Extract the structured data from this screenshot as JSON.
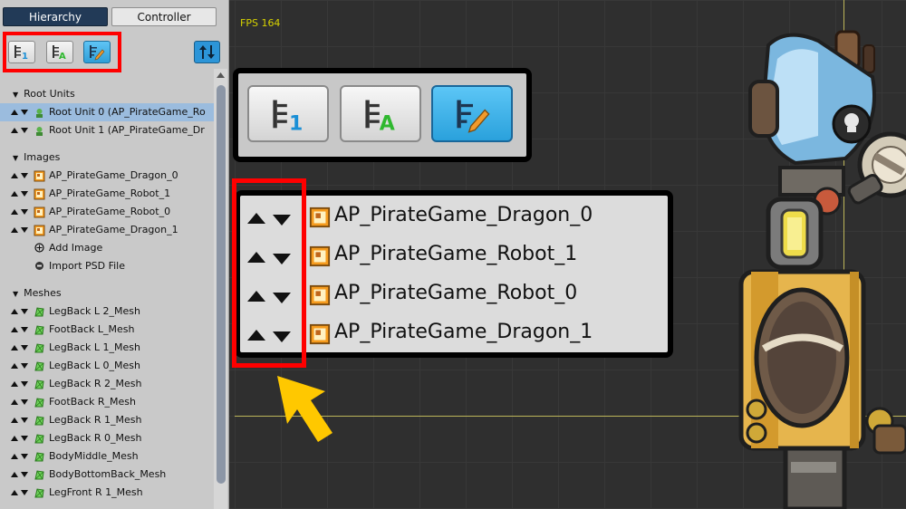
{
  "tabs": {
    "hierarchy": "Hierarchy",
    "controller": "Controller"
  },
  "viewport": {
    "fps": "FPS 164"
  },
  "sections": {
    "root_units": "Root Units",
    "images": "Images",
    "meshes": "Meshes"
  },
  "root_units": [
    {
      "label": "Root Unit 0 (AP_PirateGame_Ro",
      "selected": true
    },
    {
      "label": "Root Unit 1 (AP_PirateGame_Dr",
      "selected": false
    }
  ],
  "images": [
    {
      "label": "AP_PirateGame_Dragon_0"
    },
    {
      "label": "AP_PirateGame_Robot_1"
    },
    {
      "label": "AP_PirateGame_Robot_0"
    },
    {
      "label": "AP_PirateGame_Dragon_1"
    }
  ],
  "image_actions": {
    "add_image": "Add Image",
    "import_psd": "Import PSD File"
  },
  "meshes": [
    {
      "label": "LegBack L 2_Mesh"
    },
    {
      "label": "FootBack L_Mesh"
    },
    {
      "label": "LegBack L 1_Mesh"
    },
    {
      "label": "LegBack L 0_Mesh"
    },
    {
      "label": "LegBack R 2_Mesh"
    },
    {
      "label": "FootBack R_Mesh"
    },
    {
      "label": "LegBack R 1_Mesh"
    },
    {
      "label": "LegBack R 0_Mesh"
    },
    {
      "label": "BodyMiddle_Mesh"
    },
    {
      "label": "BodyBottomBack_Mesh"
    },
    {
      "label": "LegFront R 1_Mesh"
    }
  ],
  "zoom_list": [
    {
      "label": "AP_PirateGame_Dragon_0"
    },
    {
      "label": "AP_PirateGame_Robot_1"
    },
    {
      "label": "AP_PirateGame_Robot_0"
    },
    {
      "label": "AP_PirateGame_Dragon_1"
    }
  ],
  "icons": {
    "sort_by_number": "sort-number-icon",
    "sort_alphabetical": "sort-alpha-icon",
    "sort_custom": "sort-custom-edit-icon",
    "toggle_order": "swap-vertical-icon"
  },
  "colors": {
    "accent_red": "#ff0000",
    "accent_yellow": "#ffc800",
    "selection": "#9bbcde",
    "button_blue": "#2c95d8"
  }
}
